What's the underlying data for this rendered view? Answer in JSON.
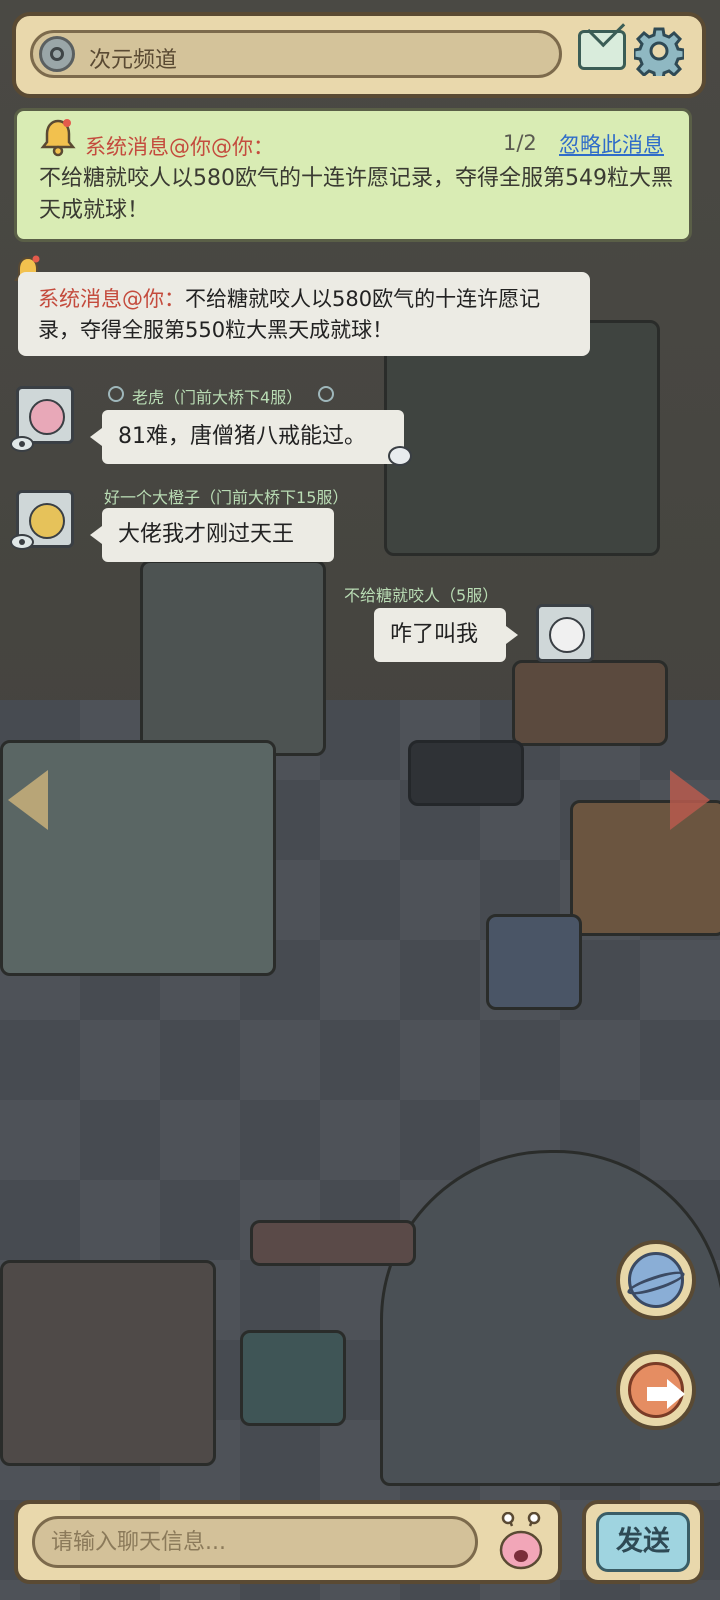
{
  "header": {
    "channel_label": "次元频道"
  },
  "system_notice": {
    "title": "系统消息@你@你：",
    "pager": "1/2",
    "ignore_label": "忽略此消息",
    "body": "不给糖就咬人以580欧气的十连许愿记录，夺得全服第549粒大黑天成就球！"
  },
  "system_notice_2": {
    "title": "系统消息@你：",
    "body": "不给糖就咬人以580欧气的十连许愿记录，夺得全服第550粒大黑天成就球！"
  },
  "messages": [
    {
      "sender": "老虎",
      "server": "（门前大桥下4服）",
      "text": "81难，唐僧猪八戒能过。"
    },
    {
      "sender": "好一个大橙子",
      "server": "（门前大桥下15服）",
      "text": "大佬我才刚过天王"
    },
    {
      "sender": "不给糖就咬人",
      "server": "（5服）",
      "text": "咋了叫我"
    }
  ],
  "input": {
    "placeholder": "请输入聊天信息..."
  },
  "send_label": "发送",
  "colors": {
    "panel_bg": "#e9d8ac",
    "notice_bg": "#d9ecb4",
    "system_red": "#c44b3d",
    "link_blue": "#2f6cc9"
  },
  "icons": [
    "channel-icon",
    "mail-icon",
    "gear-icon",
    "bell-icon",
    "eye-icon",
    "planet-icon",
    "arrow-right-icon",
    "emoji-icon"
  ]
}
